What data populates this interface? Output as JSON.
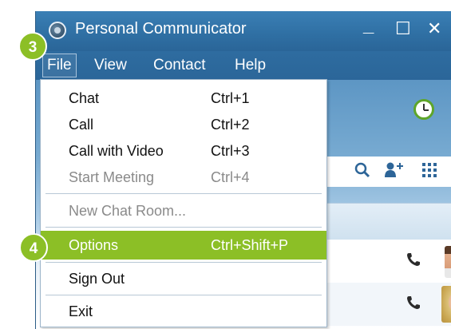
{
  "window": {
    "title": "Personal Communicator",
    "minimize_glyph": "_",
    "maximize_glyph": "☐",
    "close_glyph": "✕"
  },
  "menubar": {
    "items": [
      {
        "label": "File"
      },
      {
        "label": "View"
      },
      {
        "label": "Contact"
      },
      {
        "label": "Help"
      }
    ]
  },
  "file_menu": {
    "items": [
      {
        "label": "Chat",
        "shortcut": "Ctrl+1",
        "enabled": true
      },
      {
        "label": "Call",
        "shortcut": "Ctrl+2",
        "enabled": true
      },
      {
        "label": "Call with Video",
        "shortcut": "Ctrl+3",
        "enabled": true
      },
      {
        "label": "Start Meeting",
        "shortcut": "Ctrl+4",
        "enabled": false
      },
      {
        "label": "New Chat Room...",
        "shortcut": "",
        "enabled": false
      },
      {
        "label": "Options",
        "shortcut": "Ctrl+Shift+P",
        "enabled": true,
        "highlighted": true
      },
      {
        "label": "Sign Out",
        "shortcut": "",
        "enabled": true
      },
      {
        "label": "Exit",
        "shortcut": "",
        "enabled": true
      }
    ]
  },
  "annotations": {
    "step_file": "3",
    "step_options": "4",
    "badge_color": "#8cbf26"
  },
  "icons": {
    "app": "app-logo-icon",
    "clock": "clock-icon",
    "search": "search-icon",
    "add_contact": "add-contact-icon",
    "grid": "dialpad-grid-icon",
    "phone": "phone-icon"
  },
  "colors": {
    "titlebar": "#2f6fa3",
    "highlight": "#8cbf26",
    "disabled_text": "#8a8a8a"
  }
}
